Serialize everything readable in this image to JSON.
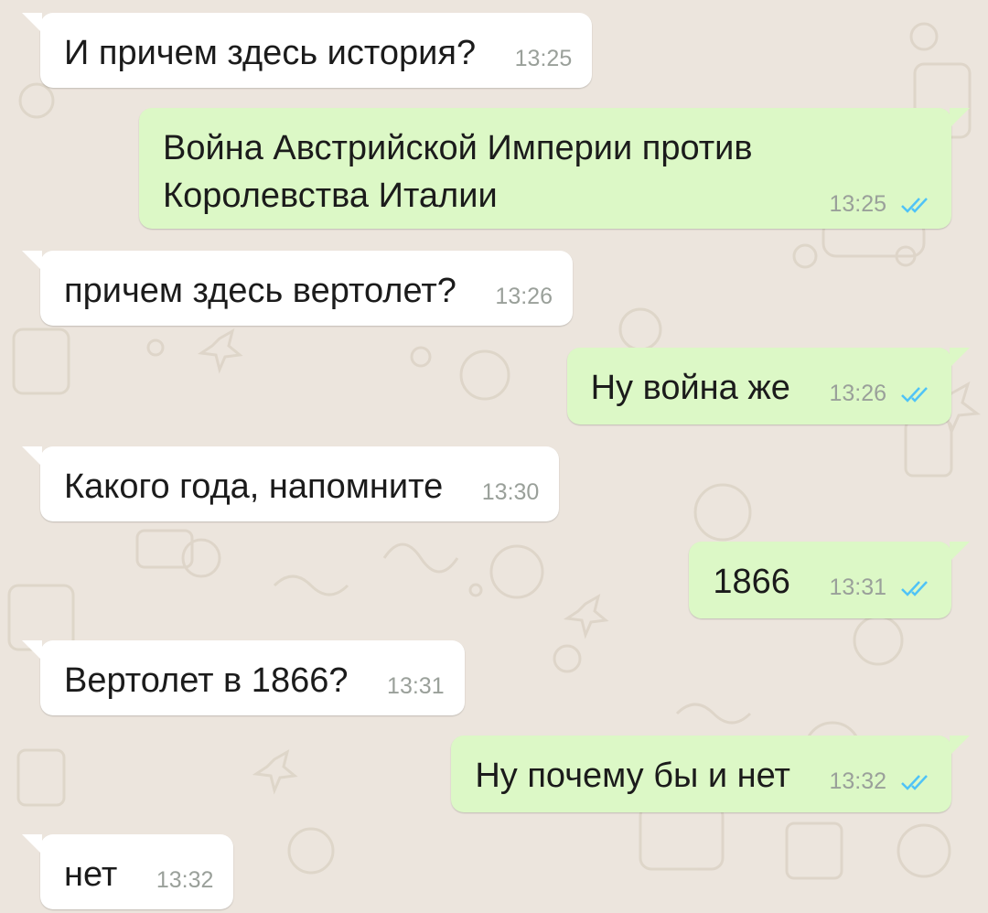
{
  "chat": {
    "messages": [
      {
        "direction": "in",
        "text": "И причем здесь история?",
        "time": "13:25"
      },
      {
        "direction": "out",
        "text": "Война Австрийской Империи против",
        "text2": "Королевства Италии",
        "time": "13:25",
        "status_icon": "double-check-read-icon"
      },
      {
        "direction": "in",
        "text": "причем здесь вертолет?",
        "time": "13:26"
      },
      {
        "direction": "out",
        "text": "Ну война же",
        "time": "13:26",
        "status_icon": "double-check-read-icon"
      },
      {
        "direction": "in",
        "text": "Какого года, напомните",
        "time": "13:30"
      },
      {
        "direction": "out",
        "text": "1866",
        "time": "13:31",
        "status_icon": "double-check-read-icon"
      },
      {
        "direction": "in",
        "text": "Вертолет в 1866?",
        "time": "13:31"
      },
      {
        "direction": "out",
        "text": "Ну почему бы и нет",
        "time": "13:32",
        "status_icon": "double-check-read-icon"
      },
      {
        "direction": "in",
        "text": "нет",
        "time": "13:32"
      }
    ]
  },
  "colors": {
    "background": "#ece5dd",
    "incoming_bubble": "#ffffff",
    "outgoing_bubble": "#dcf8c6",
    "read_ticks": "#4fc3f7",
    "timestamp": "#9aa09a"
  }
}
